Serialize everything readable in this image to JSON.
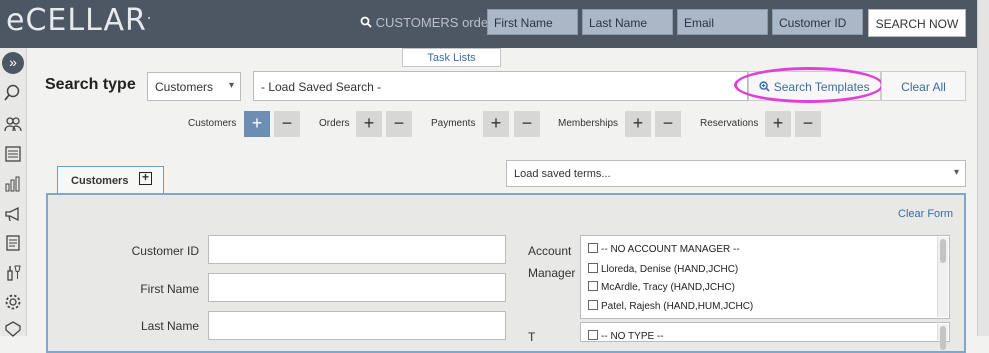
{
  "header": {
    "logo": "eCELLAR",
    "logo_mark": ".",
    "search_label": "CUSTOMERS",
    "search_scope": "orders",
    "fields": [
      "First Name",
      "Last Name",
      "Email",
      "Customer ID"
    ],
    "search_button": "SEARCH NOW"
  },
  "sidebar": {
    "expand_glyph": "»",
    "icons": [
      "search-icon",
      "users-icon",
      "list-icon",
      "reports-chart-icon",
      "megaphone-icon",
      "document-icon",
      "wine-icon",
      "gear-icon",
      "tag-icon"
    ]
  },
  "task_lists": "Task Lists",
  "search": {
    "title": "Search type",
    "type_value": "Customers",
    "saved_search": "- Load Saved Search -",
    "templates_button": "Search Templates",
    "clear_all": "Clear All",
    "highlight_color": "#e040d8"
  },
  "toggles": [
    {
      "label": "Customers",
      "plus": "+",
      "minus": "−",
      "active": true
    },
    {
      "label": "Orders",
      "plus": "+",
      "minus": "−",
      "active": false
    },
    {
      "label": "Payments",
      "plus": "+",
      "minus": "−",
      "active": false
    },
    {
      "label": "Memberships",
      "plus": "+",
      "minus": "−",
      "active": false
    },
    {
      "label": "Reservations",
      "plus": "+",
      "minus": "−",
      "active": false
    }
  ],
  "tab": {
    "label": "Customers",
    "add": "+"
  },
  "load_terms": "Load saved terms...",
  "form": {
    "clear_form": "Clear Form",
    "labels": {
      "customer_id": "Customer ID",
      "first_name": "First Name",
      "last_name": "Last Name"
    },
    "account_manager_label_1": "Account",
    "account_manager_label_2": "Manager",
    "type_label": "T",
    "account_managers": [
      "-- NO ACCOUNT MANAGER --",
      "Lloreda, Denise (HAND,JCHC)",
      "McArdle, Tracy (HAND,JCHC)",
      "Patel, Rajesh (HAND,HUM,JCHC)"
    ],
    "types": [
      "-- NO TYPE --"
    ]
  },
  "colors": {
    "topbar": "#4d5663",
    "accent": "#6d8eb3",
    "link": "#3a6ea5"
  }
}
